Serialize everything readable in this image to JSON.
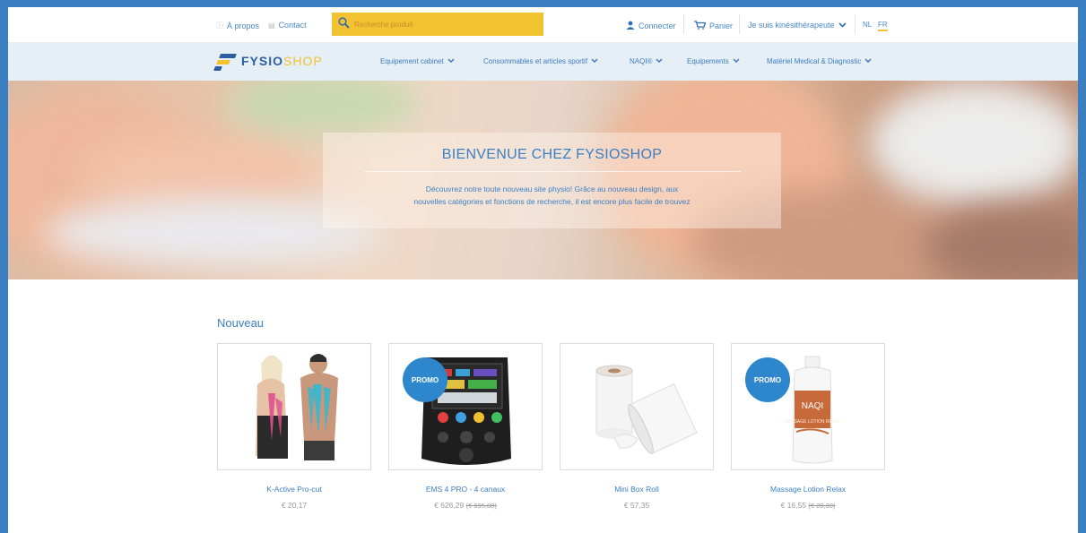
{
  "topbar": {
    "about_label": "À propos",
    "contact_label": "Contact",
    "search_placeholder": "Recherche produit",
    "login_label": "Connecter",
    "cart_label": "Panier",
    "profile_label": "Je suis kinésithérapeute",
    "lang_nl": "NL",
    "lang_fr": "FR"
  },
  "brand": {
    "part1": "FYSIO",
    "part2": "SHOP"
  },
  "nav": {
    "items": [
      {
        "label": "Equipement cabinet"
      },
      {
        "label": "Consommables et articles sportif"
      },
      {
        "label": "NAQI®"
      },
      {
        "label": "Equipements"
      },
      {
        "label": "Matériel Medical & Diagnostic"
      }
    ]
  },
  "hero": {
    "title": "BIENVENUE CHEZ FYSIOSHOP",
    "line1": "Découvrez notre toute nouveau site physio! Grâce au nouveau design, aux",
    "line2": "nouvelles catégories et fonctions de recherche, il est encore plus facile de trouvez"
  },
  "products": {
    "section_title": "Nouveau",
    "items": [
      {
        "name": "K-Active Pro-cut",
        "price": "€ 20,17",
        "old_price": "",
        "promo": false
      },
      {
        "name": "EMS 4 PRO - 4 canaux",
        "price": "€ 626,29",
        "old_price": "(€ 695,88)",
        "promo": true,
        "promo_label": "PROMO"
      },
      {
        "name": "Mini Box Roll",
        "price": "€ 57,35",
        "old_price": "",
        "promo": false
      },
      {
        "name": "Massage Lotion Relax",
        "price": "€ 16,55",
        "old_price": "(€ 20,30)",
        "promo": true,
        "promo_label": "PROMO"
      }
    ],
    "bottle_label_brand": "NAQI",
    "bottle_label_text": "MASSAGE LOTION RELAX"
  },
  "colors": {
    "frame_bg": "#3a7fc2",
    "accent_blue": "#3b7fc4",
    "search_yellow": "#f2c230",
    "nav_bg": "#e6eef6",
    "promo_blue": "#2e86cc"
  },
  "icons": [
    "info-icon",
    "contact-icon",
    "search-icon",
    "user-icon",
    "cart-icon",
    "chevron-down-icon"
  ]
}
